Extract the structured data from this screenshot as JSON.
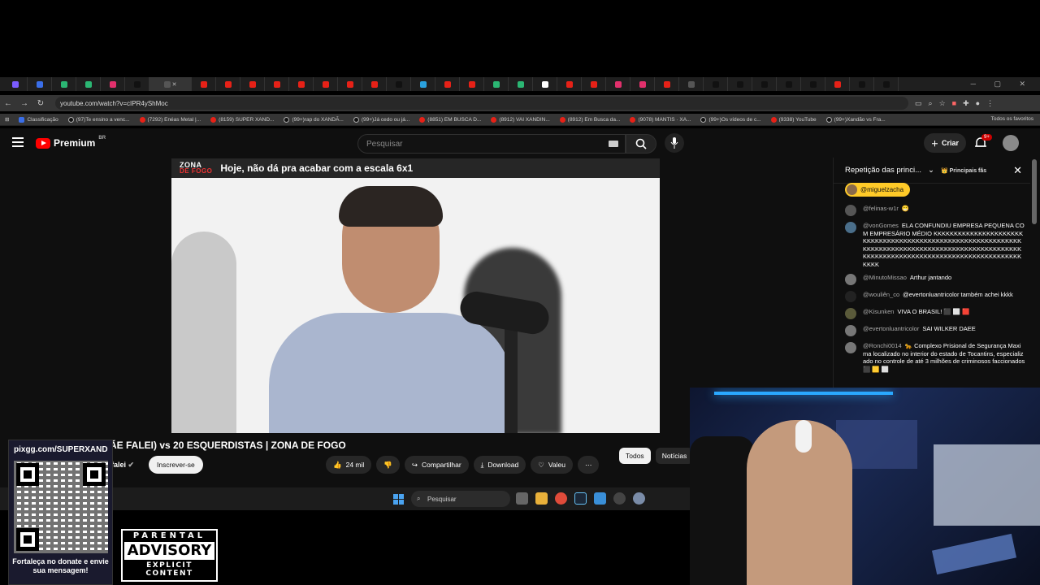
{
  "browser": {
    "url": "youtube.com/watch?v=cIPR4yShMoc",
    "all_bookmarks": "Todos os favoritos",
    "bookmarks": [
      {
        "label": "Classificação",
        "kind": "cl"
      },
      {
        "label": "(97)Te ensino a venc...",
        "kind": "tk"
      },
      {
        "label": "(7292) Enéas Metal |...",
        "kind": "yt"
      },
      {
        "label": "(8159) SUPER XAND...",
        "kind": "yt"
      },
      {
        "label": "(99+)rap do XANDÃ...",
        "kind": "tk"
      },
      {
        "label": "(99+)Já cedo ou já...",
        "kind": "tk"
      },
      {
        "label": "(8851) EM BUSCA D...",
        "kind": "yt"
      },
      {
        "label": "(8912) VAI XANDIN...",
        "kind": "yt"
      },
      {
        "label": "(8912) Em Busca da...",
        "kind": "yt"
      },
      {
        "label": "(9078) MANTIS · XA...",
        "kind": "yt"
      },
      {
        "label": "(99+)Os vídeos de c...",
        "kind": "tk"
      },
      {
        "label": "(9338) YouTube",
        "kind": "yt"
      },
      {
        "label": "(99+)Xandão vs Fra...",
        "kind": "tk"
      }
    ]
  },
  "youtube": {
    "logo_text": "Premium",
    "logo_region": "BR",
    "search_placeholder": "Pesquisar",
    "create_label": "Criar",
    "notif_count": "9+",
    "video_banner_brand_top": "ZONA",
    "video_banner_brand_bottom": "DE FOGO",
    "video_banner_text": "Hoje, não dá pra acabar com a escala 6x1",
    "video_title": "ÃE FALEI) vs 20 ESQUERDISTAS | ZONA DE FOGO",
    "channel_name": "falei",
    "subscribe_label": "Inscrever-se",
    "likes": "24 mil",
    "share_label": "Compartilhar",
    "download_label": "Download",
    "thanks_label": "Valeu",
    "chips": [
      "Todos",
      "Notícias"
    ]
  },
  "chat": {
    "title": "Repetição das princi...",
    "fans_label": "Principais fãs",
    "pinned_user": "@miguelzacha",
    "messages": [
      {
        "author": "@felinas-w1r",
        "text": "😁"
      },
      {
        "author": "@vonGomes",
        "text": "ELA CONFUNDIU EMPRESA PEQUENA COM EMPRESÁRIO MÉDIO KKKKKKKKKKKKKKKKKKKKKKKKKKKKKKKKKKKKKKKKKKKKKKKKKKKKKKKKKKKKKKKKKKKKKKKKKKKKKKKKKKKKKKKKKKKKKKKKKKKKKKKKKKKKKKKKKKKKKKKKKKKKKKKKKKKKKKKKKKKKKKK"
      },
      {
        "author": "@MinutoMissao",
        "text": "Arthur jantando"
      },
      {
        "author": "@wouliên_co",
        "text": "@evertonluantricolor também achei kkkk"
      },
      {
        "author": "@Kisunken",
        "text": "VIVA O BRASIL! ⬛ ⬜ 🟥"
      },
      {
        "author": "@evertonluantricolor",
        "text": "SAI WILKER DAEE"
      },
      {
        "author": "@Ronchi0014",
        "text": "🐆 Complexo Prisional de Segurança Maxima localizado no interior do estado de Tocantins, especializado no controle de até 3 milhões de criminosos faccionados ⬛ 🟨 ⬜"
      }
    ]
  },
  "taskbar": {
    "search_placeholder": "Pesquisar"
  },
  "overlay": {
    "qr_url": "pixgg.com/SUPERXAND",
    "qr_caption": "Fortaleça no donate e envie sua mensagem!",
    "advisory_top": "PARENTAL",
    "advisory_middle": "ADVISORY",
    "advisory_bottom": "EXPLICIT CONTENT"
  }
}
